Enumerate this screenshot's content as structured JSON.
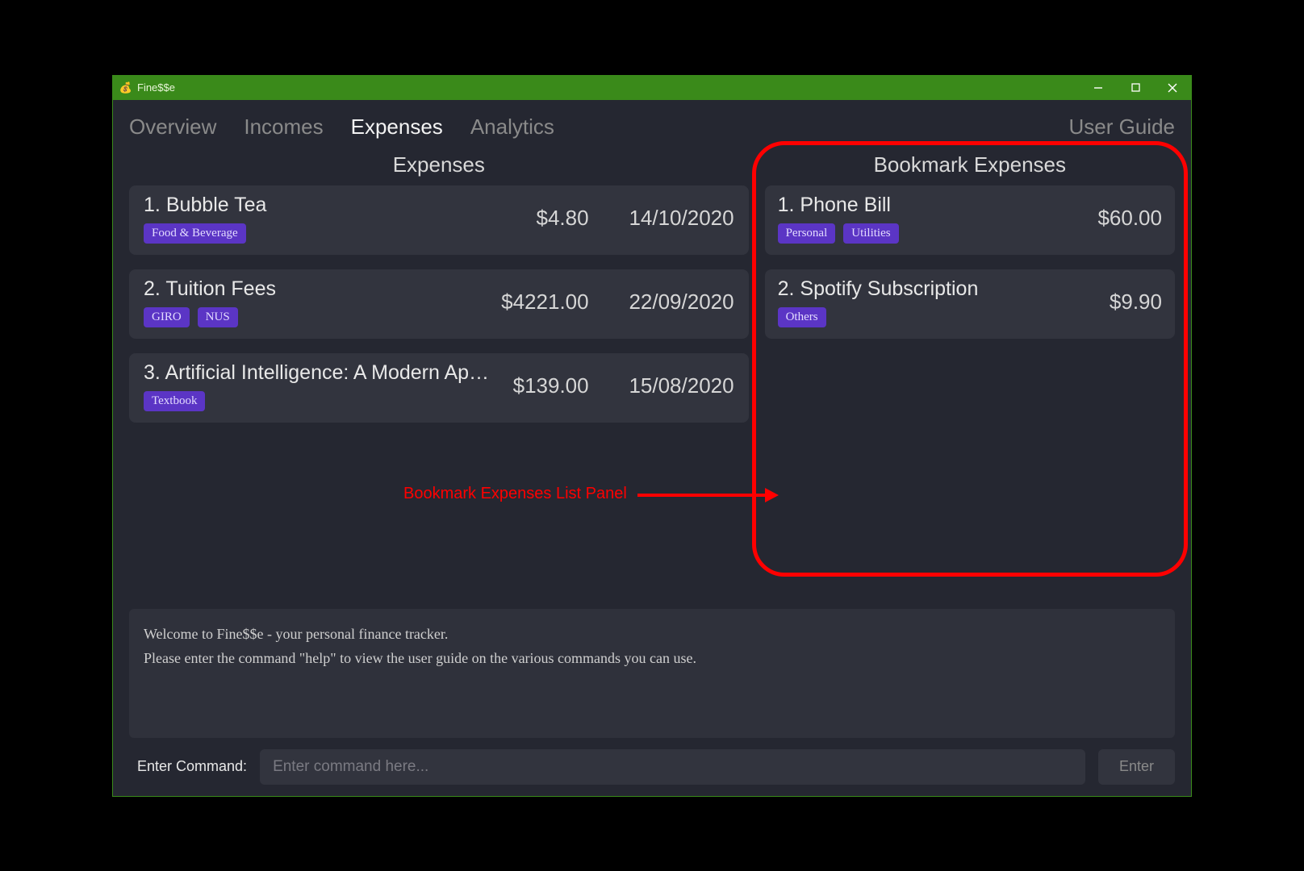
{
  "window": {
    "title": "Fine$$e",
    "icon": "💰"
  },
  "tabs": {
    "overview": "Overview",
    "incomes": "Incomes",
    "expenses": "Expenses",
    "analytics": "Analytics",
    "guide": "User Guide",
    "active": "expenses"
  },
  "panelTitles": {
    "expenses": "Expenses",
    "bookmark": "Bookmark Expenses"
  },
  "expenses": [
    {
      "idx": "1.",
      "title": "Bubble Tea",
      "tags": [
        "Food & Beverage"
      ],
      "amount": "$4.80",
      "date": "14/10/2020"
    },
    {
      "idx": "2.",
      "title": "Tuition Fees",
      "tags": [
        "GIRO",
        "NUS"
      ],
      "amount": "$4221.00",
      "date": "22/09/2020"
    },
    {
      "idx": "3.",
      "title": "Artificial Intelligence: A Modern App...",
      "tags": [
        "Textbook"
      ],
      "amount": "$139.00",
      "date": "15/08/2020"
    }
  ],
  "bookmarks": [
    {
      "idx": "1.",
      "title": "Phone Bill",
      "tags": [
        "Personal",
        "Utilities"
      ],
      "amount": "$60.00"
    },
    {
      "idx": "2.",
      "title": "Spotify Subscription",
      "tags": [
        "Others"
      ],
      "amount": "$9.90"
    }
  ],
  "annotation": {
    "label": "Bookmark Expenses List Panel"
  },
  "console": {
    "line1": "Welcome to Fine$$e - your personal finance tracker.",
    "line2": "Please enter the command \"help\" to view the user guide on the various commands you can use."
  },
  "command": {
    "label": "Enter Command:",
    "placeholder": "Enter command here...",
    "button": "Enter"
  }
}
